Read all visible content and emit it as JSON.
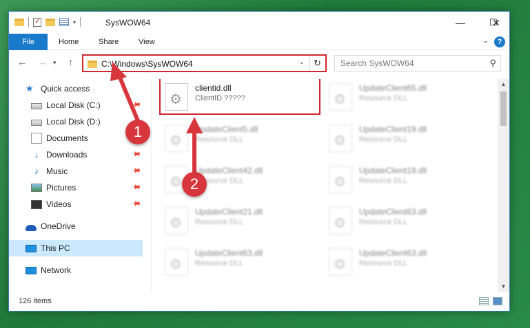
{
  "window": {
    "title": "SysWOW64",
    "controls": {
      "minimize": "—",
      "maximize": "☐",
      "close": "✕"
    }
  },
  "ribbon": {
    "tabs": [
      "File",
      "Home",
      "Share",
      "View"
    ],
    "help": "?"
  },
  "address": {
    "path": "C:\\Windows\\SysWOW64"
  },
  "search": {
    "placeholder": "Search SysWOW64"
  },
  "sidebar": {
    "items": [
      {
        "label": "Quick access",
        "icon": "star-icon",
        "pinned": false
      },
      {
        "label": "Local Disk (C:)",
        "icon": "disk-icon",
        "pinned": true
      },
      {
        "label": "Local Disk (D:)",
        "icon": "disk-icon",
        "pinned": false
      },
      {
        "label": "Documents",
        "icon": "documents-icon",
        "pinned": true
      },
      {
        "label": "Downloads",
        "icon": "download-icon",
        "pinned": true
      },
      {
        "label": "Music",
        "icon": "music-icon",
        "pinned": true
      },
      {
        "label": "Pictures",
        "icon": "pictures-icon",
        "pinned": true
      },
      {
        "label": "Videos",
        "icon": "videos-icon",
        "pinned": true
      },
      {
        "label": "OneDrive",
        "icon": "onedrive-icon",
        "pinned": false
      },
      {
        "label": "This PC",
        "icon": "pc-icon",
        "pinned": false,
        "selected": true
      },
      {
        "label": "Network",
        "icon": "network-icon",
        "pinned": false
      }
    ]
  },
  "files": {
    "left": [
      {
        "name": "clientid.dll",
        "desc": "ClientID ?????"
      },
      {
        "name": "UpdateClient5.dll",
        "desc": "Resource DLL"
      },
      {
        "name": "UpdateClient42.dll",
        "desc": "Resource DLL"
      },
      {
        "name": "UpdateClient21.dll",
        "desc": "Resource DLL"
      },
      {
        "name": "UpdateClient63.dll",
        "desc": "Resource DLL"
      }
    ],
    "right": [
      {
        "name": "UpdateClient65.dll",
        "desc": "Resource DLL"
      },
      {
        "name": "UpdateClient19.dll",
        "desc": "Resource DLL"
      },
      {
        "name": "UpdateClient19.dll",
        "desc": "Resource DLL"
      },
      {
        "name": "UpdateClient63.dll",
        "desc": "Resource DLL"
      },
      {
        "name": "UpdateClient63.dll",
        "desc": "Resource DLL"
      }
    ]
  },
  "status": {
    "item_count": "126 items"
  },
  "annotations": {
    "badge1": "1",
    "badge2": "2",
    "color": "#d8363d"
  }
}
